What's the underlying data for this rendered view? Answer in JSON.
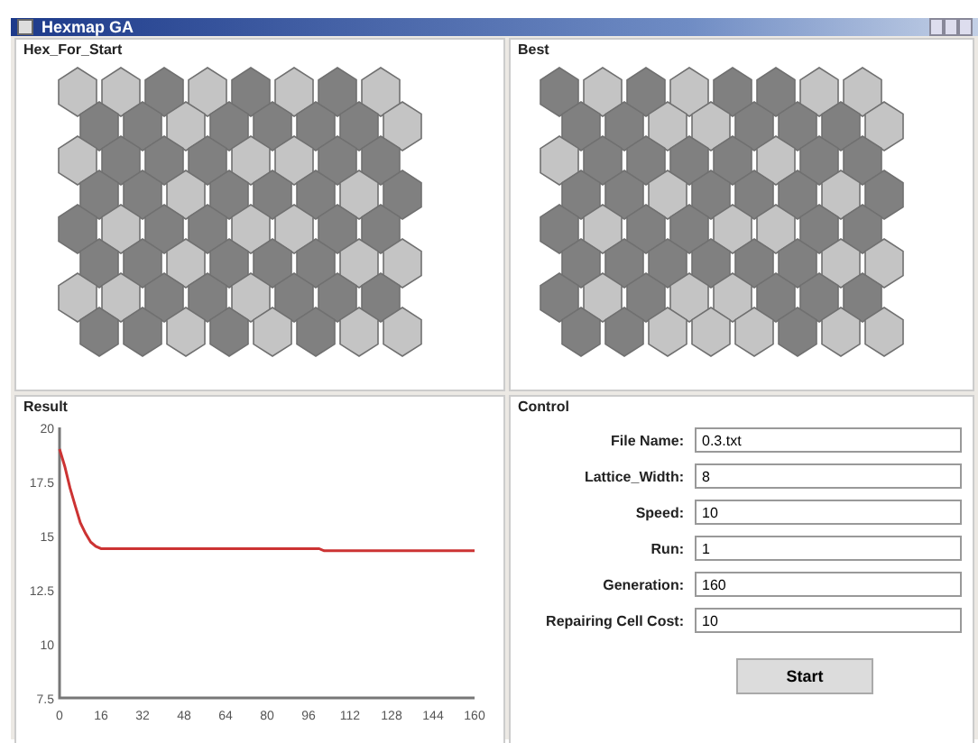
{
  "window": {
    "title": "Hexmap GA"
  },
  "grids": [
    {
      "title": "Hex_For_Start",
      "rows": [
        [
          {
            "light": true
          },
          {
            "light": true
          },
          {
            "light": false
          },
          {
            "light": true
          },
          {
            "light": false
          },
          {
            "light": true
          },
          {
            "light": false
          },
          {
            "light": true
          }
        ],
        [
          {
            "light": false
          },
          {
            "light": false
          },
          {
            "light": true
          },
          {
            "light": false
          },
          {
            "light": false
          },
          {
            "light": false
          },
          {
            "light": false
          },
          {
            "light": true
          }
        ],
        [
          {
            "light": true
          },
          {
            "light": false
          },
          {
            "light": false
          },
          {
            "light": false
          },
          {
            "light": true
          },
          {
            "light": true
          },
          {
            "light": false
          },
          {
            "light": false
          }
        ],
        [
          {
            "light": false
          },
          {
            "light": false
          },
          {
            "light": true
          },
          {
            "light": false
          },
          {
            "light": false
          },
          {
            "light": false
          },
          {
            "light": true
          },
          {
            "light": false
          }
        ],
        [
          {
            "light": false
          },
          {
            "light": true
          },
          {
            "light": false
          },
          {
            "light": false
          },
          {
            "light": true
          },
          {
            "light": true
          },
          {
            "light": false
          },
          {
            "light": false
          }
        ],
        [
          {
            "light": false
          },
          {
            "light": false
          },
          {
            "light": true
          },
          {
            "light": false
          },
          {
            "light": false
          },
          {
            "light": false
          },
          {
            "light": true
          },
          {
            "light": true
          }
        ],
        [
          {
            "light": true
          },
          {
            "light": true
          },
          {
            "light": false
          },
          {
            "light": false
          },
          {
            "light": true
          },
          {
            "light": false
          },
          {
            "light": false
          },
          {
            "light": false
          }
        ],
        [
          {
            "light": false
          },
          {
            "light": false
          },
          {
            "light": true
          },
          {
            "light": false
          },
          {
            "light": true
          },
          {
            "light": false
          },
          {
            "light": true
          },
          {
            "light": true
          }
        ]
      ]
    },
    {
      "title": "Best",
      "rows": [
        [
          {
            "light": false
          },
          {
            "light": true
          },
          {
            "light": false
          },
          {
            "light": true
          },
          {
            "light": false
          },
          {
            "light": false
          },
          {
            "light": true
          },
          {
            "light": true
          }
        ],
        [
          {
            "light": false
          },
          {
            "light": false
          },
          {
            "light": true
          },
          {
            "light": true
          },
          {
            "light": false
          },
          {
            "light": false
          },
          {
            "light": false
          },
          {
            "light": true
          }
        ],
        [
          {
            "light": true
          },
          {
            "light": false
          },
          {
            "light": false
          },
          {
            "light": false
          },
          {
            "light": false
          },
          {
            "light": true
          },
          {
            "light": false
          },
          {
            "light": false
          }
        ],
        [
          {
            "light": false
          },
          {
            "light": false
          },
          {
            "light": true
          },
          {
            "light": false
          },
          {
            "light": false
          },
          {
            "light": false
          },
          {
            "light": true
          },
          {
            "light": false
          }
        ],
        [
          {
            "light": false
          },
          {
            "light": true
          },
          {
            "light": false
          },
          {
            "light": false
          },
          {
            "light": true
          },
          {
            "light": true
          },
          {
            "light": false
          },
          {
            "light": false
          }
        ],
        [
          {
            "light": false
          },
          {
            "light": false
          },
          {
            "light": false
          },
          {
            "light": false
          },
          {
            "light": false
          },
          {
            "light": false
          },
          {
            "light": true
          },
          {
            "light": true
          }
        ],
        [
          {
            "light": false
          },
          {
            "light": true
          },
          {
            "light": false
          },
          {
            "light": true
          },
          {
            "light": true
          },
          {
            "light": false
          },
          {
            "light": false
          },
          {
            "light": false
          }
        ],
        [
          {
            "light": false
          },
          {
            "light": false
          },
          {
            "light": true
          },
          {
            "light": true
          },
          {
            "light": true
          },
          {
            "light": false
          },
          {
            "light": true
          },
          {
            "light": true
          }
        ]
      ]
    }
  ],
  "result": {
    "title": "Result",
    "chart_data": {
      "type": "line",
      "x": [
        0,
        2,
        4,
        6,
        8,
        10,
        12,
        14,
        16,
        20,
        100,
        102,
        160
      ],
      "series": [
        {
          "color": "#cc3333",
          "values": [
            19,
            18.2,
            17.2,
            16.4,
            15.6,
            15.1,
            14.7,
            14.5,
            14.4,
            14.4,
            14.4,
            14.3,
            14.3
          ]
        }
      ],
      "xlim": [
        0,
        160
      ],
      "ylim": [
        7.5,
        20
      ],
      "xticks": [
        0,
        16,
        32,
        48,
        64,
        80,
        96,
        112,
        128,
        144,
        160
      ],
      "yticks": [
        7.5,
        10,
        12.5,
        15,
        17.5,
        20
      ]
    }
  },
  "control": {
    "title": "Control",
    "fields": [
      {
        "label": "File Name:",
        "value": "0.3.txt"
      },
      {
        "label": "Lattice_Width:",
        "value": "8"
      },
      {
        "label": "Speed:",
        "value": "10"
      },
      {
        "label": "Run:",
        "value": "1"
      },
      {
        "label": "Generation:",
        "value": "160"
      },
      {
        "label": "Repairing Cell Cost:",
        "value": "10"
      }
    ],
    "button": "Start"
  }
}
